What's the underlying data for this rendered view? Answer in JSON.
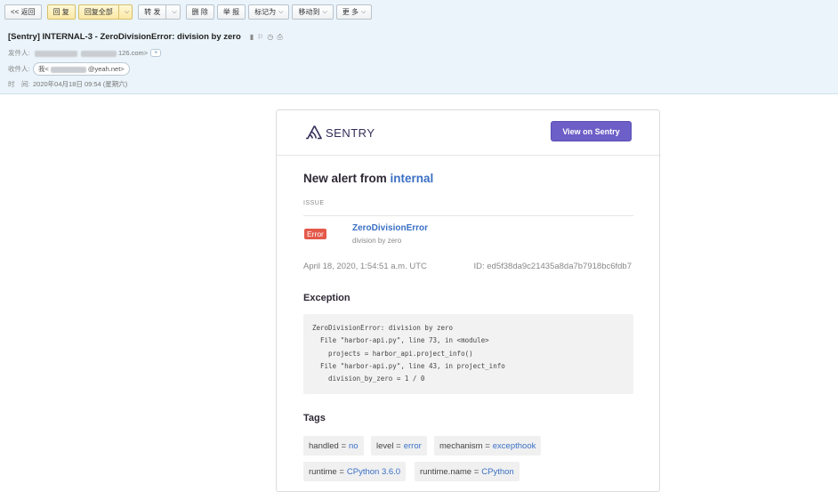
{
  "toolbar": {
    "back": "<< 返回",
    "reply": "回 复",
    "reply_all": "回复全部",
    "forward": "转 发",
    "delete": "删 除",
    "report": "举 报",
    "mark_as": "标记为",
    "move_to": "移动到",
    "more": "更 多"
  },
  "mail": {
    "subject": "[Sentry] INTERNAL-3 - ZeroDivisionError: division by zero",
    "from_label": "发件人:",
    "from_suffix": "126.com>",
    "to_label": "收件人:",
    "to_prefix": "我<",
    "to_suffix": "@yeah.net>",
    "time_label": "时　间:",
    "time_value": "2020年04月18日 09:54 (星期六)"
  },
  "card": {
    "brand": "SENTRY",
    "view_button": "View on Sentry",
    "alert_prefix": "New alert from",
    "project": "internal",
    "issue_label": "ISSUE",
    "level": "Error",
    "issue_title": "ZeroDivisionError",
    "issue_subtitle": "division by zero",
    "date": "April 18, 2020, 1:54:51 a.m. UTC",
    "event_id": "ID: ed5f38da9c21435a8da7b7918bc6fdb7",
    "exception_title": "Exception",
    "stacktrace": "ZeroDivisionError: division by zero\n  File \"harbor-api.py\", line 73, in <module>\n    projects = harbor_api.project_info()\n  File \"harbor-api.py\", line 43, in project_info\n    division_by_zero = 1 / 0",
    "tags_title": "Tags",
    "tags": [
      {
        "key": "handled =",
        "value": "no"
      },
      {
        "key": "level =",
        "value": "error"
      },
      {
        "key": "mechanism =",
        "value": "excepthook"
      },
      {
        "key": "runtime =",
        "value": "CPython 3.6.0"
      },
      {
        "key": "runtime.name =",
        "value": "CPython"
      }
    ]
  },
  "colors": {
    "header_bg": "#eaf4fa",
    "sentry_purple": "#6c5fc7",
    "link_blue": "#3b70c4",
    "error_red": "#e4594a"
  }
}
